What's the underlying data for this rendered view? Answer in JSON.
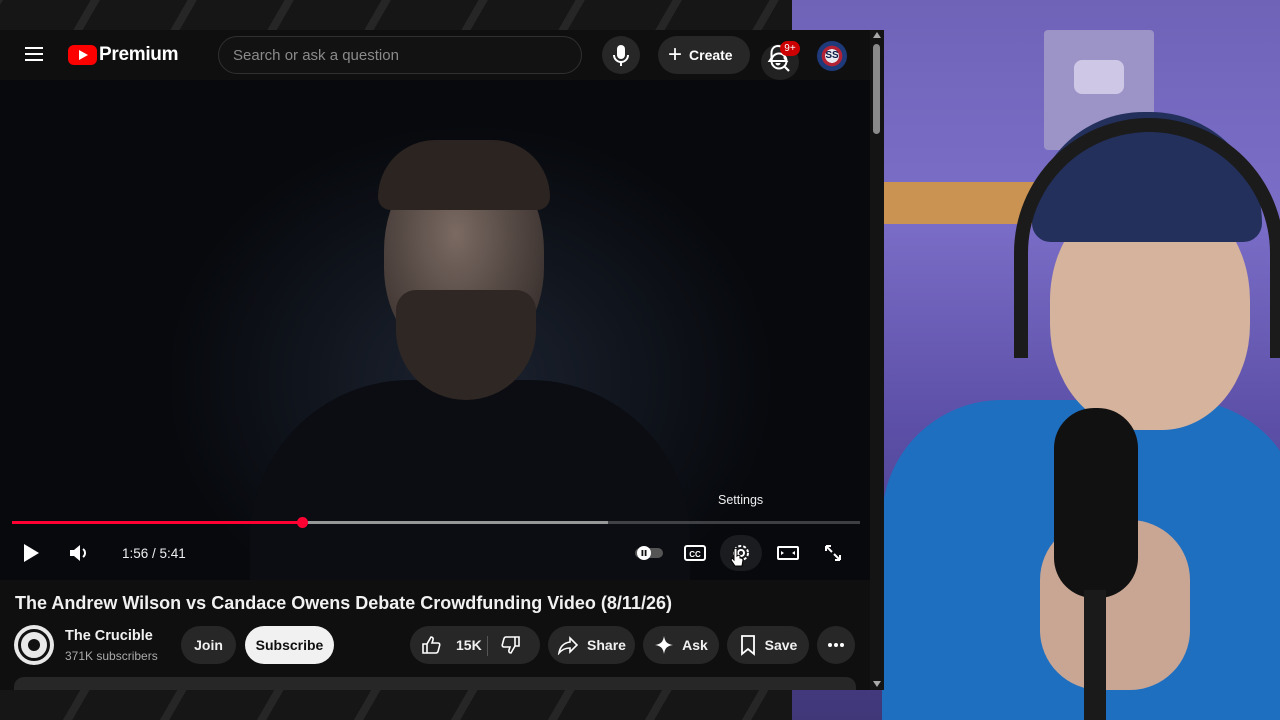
{
  "header": {
    "logo_text": "Premium",
    "search_placeholder": "Search or ask a question",
    "create_label": "Create",
    "notification_badge": "9+",
    "avatar_text": "SS"
  },
  "player": {
    "tooltip": "Settings",
    "current_time": "1:56",
    "duration": "5:41",
    "time_display": "1:56 / 5:41",
    "progress_fraction": 0.342,
    "buffered_fraction": 0.703,
    "colors": {
      "played": "#ff0033",
      "brand": "#ff0000"
    }
  },
  "video": {
    "title": "The Andrew Wilson vs Candace Owens Debate Crowdfunding Video (8/11/26)"
  },
  "channel": {
    "name": "The Crucible",
    "subscribers": "371K subscribers",
    "join_label": "Join",
    "subscribe_label": "Subscribe"
  },
  "actions": {
    "likes": "15K",
    "share_label": "Share",
    "ask_label": "Ask",
    "save_label": "Save"
  },
  "icons": [
    "menu-icon",
    "youtube-logo-icon",
    "search-icon",
    "mic-icon",
    "plus-icon",
    "bell-icon",
    "play-icon",
    "volume-icon",
    "autoplay-toggle-icon",
    "captions-icon",
    "settings-icon",
    "theater-icon",
    "fullscreen-icon",
    "like-icon",
    "dislike-icon",
    "share-icon",
    "sparkle-icon",
    "bookmark-icon",
    "more-icon"
  ]
}
